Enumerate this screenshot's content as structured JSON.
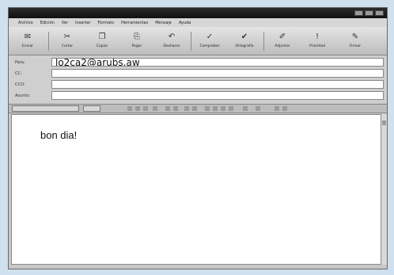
{
  "menu": [
    "Archivo",
    "Edición",
    "Ver",
    "Insertar",
    "Formato",
    "Herramientas",
    "Mensaje",
    "Ayuda"
  ],
  "toolbar": {
    "buttons": [
      {
        "label": "Enviar",
        "icon": "send-icon"
      },
      {
        "label": "Cortar",
        "icon": "scissors-icon"
      },
      {
        "label": "Copiar",
        "icon": "copy-icon"
      },
      {
        "label": "Pegar",
        "icon": "paste-icon"
      },
      {
        "label": "Deshacer",
        "icon": "undo-icon"
      },
      {
        "label": "Comprobar",
        "icon": "check-names-icon"
      },
      {
        "label": "Ortografía",
        "icon": "spelling-icon"
      },
      {
        "label": "Adjuntar",
        "icon": "attach-icon"
      },
      {
        "label": "Prioridad",
        "icon": "priority-icon"
      },
      {
        "label": "Firmar",
        "icon": "sign-icon"
      }
    ]
  },
  "header": {
    "to": {
      "label": "Para:",
      "value": "lo2ca2@arubs.aw"
    },
    "cc": {
      "label": "CC:",
      "value": ""
    },
    "bcc": {
      "label": "CCO:",
      "value": ""
    },
    "subject": {
      "label": "Asunto:",
      "value": ""
    }
  },
  "message": {
    "body": "bon dia!"
  }
}
